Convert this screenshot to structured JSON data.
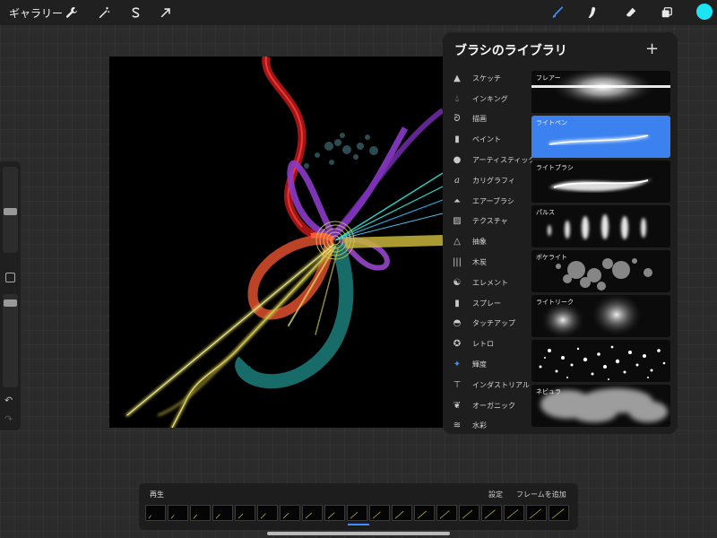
{
  "topbar": {
    "gallery_label": "ギャラリー",
    "left_tools": [
      {
        "icon": "wrench-icon",
        "name": "actions"
      },
      {
        "icon": "magic-wand-icon",
        "name": "adjustments"
      },
      {
        "icon": "selection-s-icon",
        "name": "selection"
      },
      {
        "icon": "arrow-cursor-icon",
        "name": "transform"
      }
    ],
    "right_tools": [
      {
        "icon": "brush-icon",
        "name": "paint",
        "active": true
      },
      {
        "icon": "smudge-icon",
        "name": "smudge"
      },
      {
        "icon": "eraser-icon",
        "name": "eraser"
      },
      {
        "icon": "layers-icon",
        "name": "layers"
      }
    ],
    "color": "#1ce5f3"
  },
  "sidebar": {
    "size_level": 0.25,
    "opacity_level": 0.08,
    "undo_icon": "undo-icon",
    "redo_icon": "redo-icon"
  },
  "brush_library": {
    "title": "ブラシのライブラリ",
    "add_icon": "plus-icon",
    "categories": [
      {
        "label": "スケッチ",
        "icon": "pencil-tip-icon"
      },
      {
        "label": "インキング",
        "icon": "ink-drop-icon"
      },
      {
        "label": "描画",
        "icon": "swirl-icon"
      },
      {
        "label": "ペイント",
        "icon": "paintbrush-icon"
      },
      {
        "label": "アーティスティック",
        "icon": "palette-icon"
      },
      {
        "label": "カリグラフィ",
        "icon": "calligraphy-a-icon"
      },
      {
        "label": "エアーブラシ",
        "icon": "airbrush-icon"
      },
      {
        "label": "テクスチャ",
        "icon": "texture-icon"
      },
      {
        "label": "抽象",
        "icon": "triangle-icon"
      },
      {
        "label": "木炭",
        "icon": "charcoal-icon"
      },
      {
        "label": "エレメント",
        "icon": "yin-yang-icon"
      },
      {
        "label": "スプレー",
        "icon": "spray-can-icon"
      },
      {
        "label": "タッチアップ",
        "icon": "touchup-icon"
      },
      {
        "label": "レトロ",
        "icon": "retro-star-icon"
      },
      {
        "label": "輝度",
        "icon": "sparkle-icon",
        "active": true
      },
      {
        "label": "インダストリアル",
        "icon": "anvil-icon"
      },
      {
        "label": "オーガニック",
        "icon": "leaf-icon"
      },
      {
        "label": "水彩",
        "icon": "waves-icon"
      }
    ],
    "brushes": [
      {
        "name": "フレアー",
        "preview": "flare"
      },
      {
        "name": "ライトペン",
        "preview": "lightpen",
        "selected": true
      },
      {
        "name": "ライトブラシ",
        "preview": "lightbrush"
      },
      {
        "name": "パルス",
        "preview": "pulse"
      },
      {
        "name": "ボケライト",
        "preview": "bokeh"
      },
      {
        "name": "ライトリーク",
        "preview": "lightleak"
      },
      {
        "name": "",
        "preview": "glitter"
      },
      {
        "name": "ネビュラ",
        "preview": "nebula"
      }
    ],
    "selected_color": "#3b82f0"
  },
  "animation": {
    "play_label": "再生",
    "settings_label": "設定",
    "add_frame_label": "フレームを追加",
    "frame_count": 19,
    "current_frame": 10
  }
}
